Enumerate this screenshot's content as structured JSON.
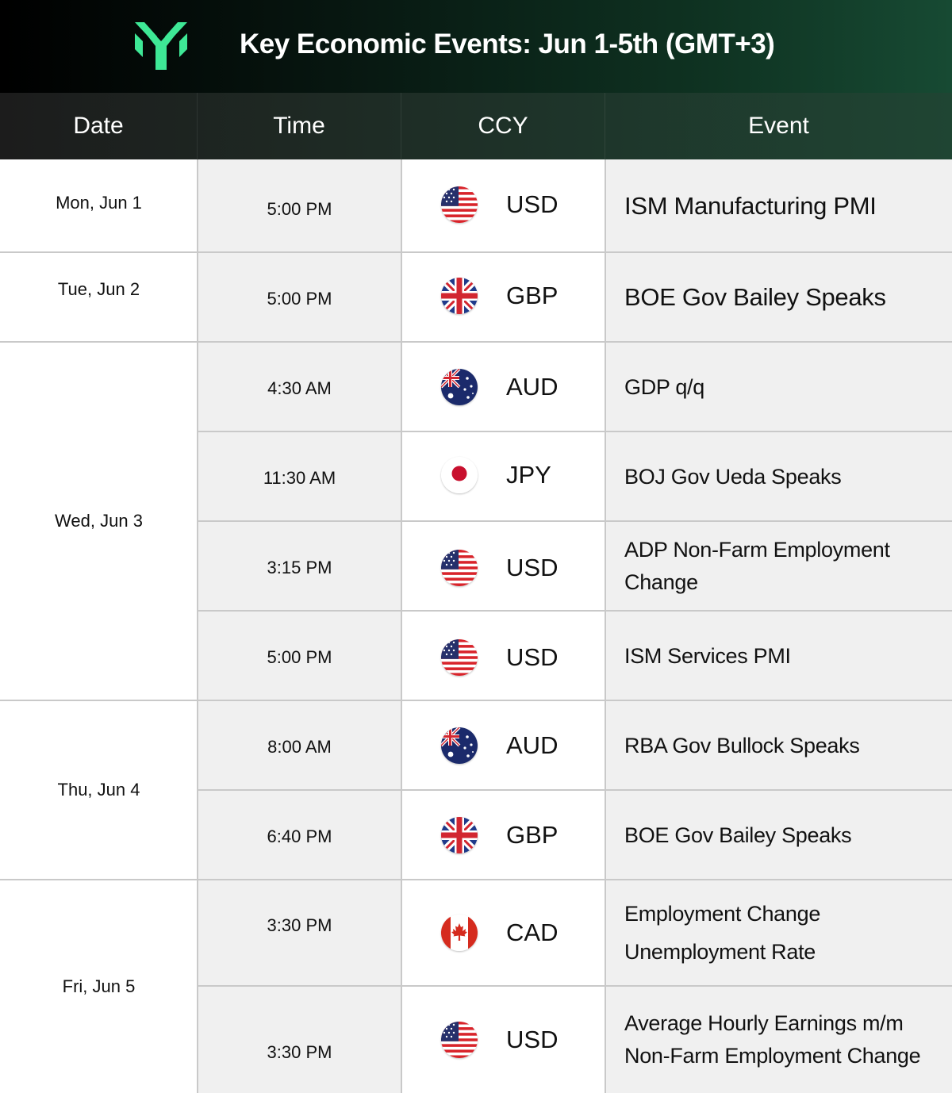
{
  "header": {
    "title": "Key Economic Events: Jun 1-5th (GMT+3)",
    "logo_icon": "brand-logo-icon",
    "accent_color": "#3ee896"
  },
  "columns": [
    "Date",
    "Time",
    "CCY",
    "Event"
  ],
  "date_groups": [
    {
      "label": "Mon, Jun 1"
    },
    {
      "label": "Tue, Jun 2"
    },
    {
      "label": "Wed, Jun 3"
    },
    {
      "label": "Thu, Jun 4"
    },
    {
      "label": "Fri, Jun 5"
    }
  ],
  "rows": [
    {
      "time": "5:00 PM",
      "ccy": "USD",
      "flag": "us-flag-icon",
      "event": [
        "ISM Manufacturing PMI"
      ]
    },
    {
      "time": "5:00 PM",
      "ccy": "GBP",
      "flag": "uk-flag-icon",
      "event": [
        "BOE Gov Bailey Speaks"
      ]
    },
    {
      "time": "4:30 AM",
      "ccy": "AUD",
      "flag": "australia-flag-icon",
      "event": [
        "GDP q/q"
      ]
    },
    {
      "time": "11:30 AM",
      "ccy": "JPY",
      "flag": "japan-flag-icon",
      "event": [
        "BOJ Gov Ueda Speaks"
      ]
    },
    {
      "time": "3:15 PM",
      "ccy": "USD",
      "flag": "us-flag-icon",
      "event": [
        "ADP Non-Farm Employment",
        "Change"
      ]
    },
    {
      "time": "5:00 PM",
      "ccy": "USD",
      "flag": "us-flag-icon",
      "event": [
        "ISM Services PMI"
      ]
    },
    {
      "time": "8:00 AM",
      "ccy": "AUD",
      "flag": "australia-flag-icon",
      "event": [
        "RBA Gov Bullock Speaks"
      ]
    },
    {
      "time": "6:40 PM",
      "ccy": "GBP",
      "flag": "uk-flag-icon",
      "event": [
        "BOE Gov Bailey Speaks"
      ]
    },
    {
      "time": "3:30 PM",
      "ccy": "CAD",
      "flag": "canada-flag-icon",
      "event": [
        "Employment Change",
        "Unemployment Rate"
      ]
    },
    {
      "time": "3:30 PM",
      "ccy": "USD",
      "flag": "us-flag-icon",
      "event": [
        "Average Hourly Earnings m/m",
        "Non-Farm Employment Change"
      ]
    }
  ]
}
